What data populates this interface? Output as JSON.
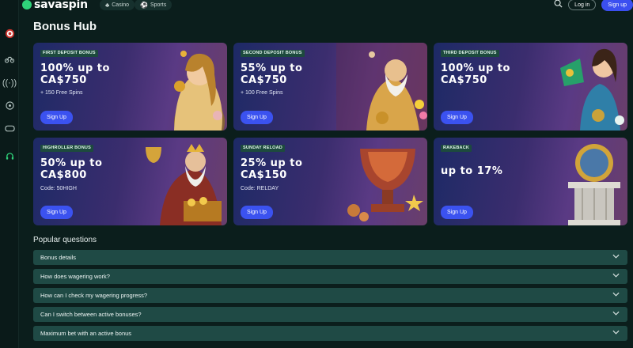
{
  "brand": {
    "name": "savaspin",
    "accent": "#2fd27a"
  },
  "header": {
    "nav": [
      {
        "label": "Casino",
        "icon": "casino-chip-icon"
      },
      {
        "label": "Sports",
        "icon": "soccer-ball-icon"
      }
    ],
    "login_label": "Log in",
    "signup_label": "Sign up"
  },
  "sidebar": {
    "icons": [
      "dartboard-icon",
      "bicycle-icon",
      "broadcast-icon",
      "soccer-ball-icon",
      "gamepad-icon",
      "headset-icon"
    ]
  },
  "page": {
    "title": "Bonus Hub"
  },
  "bonuses": [
    {
      "tag": "FIRST DEPOSIT BONUS",
      "headline": "100% up to CA$750",
      "sub": "+ 150 Free Spins",
      "cta": "Sign Up"
    },
    {
      "tag": "SECOND DEPOSIT BONUS",
      "headline": "55% up to CA$750",
      "sub": "+ 100 Free Spins",
      "cta": "Sign Up"
    },
    {
      "tag": "THIRD DEPOSIT BONUS",
      "headline": "100% up to CA$750",
      "sub": "",
      "cta": "Sign Up"
    },
    {
      "tag": "HIGHROLLER BONUS",
      "headline": "50% up to CA$800",
      "sub": "Code: 50HIGH",
      "cta": "Sign Up"
    },
    {
      "tag": "SUNDAY RELOAD",
      "headline": "25% up to CA$150",
      "sub": "Code: RELDAY",
      "cta": "Sign Up"
    },
    {
      "tag": "RAKEBACK",
      "headline": "up to 17%",
      "sub": "",
      "cta": "Sign Up"
    }
  ],
  "faq": {
    "title": "Popular questions",
    "items": [
      "Bonus details",
      "How does wagering work?",
      "How can I check my wagering progress?",
      "Can I switch between active bonuses?",
      "Maximum bet with an active bonus"
    ]
  }
}
